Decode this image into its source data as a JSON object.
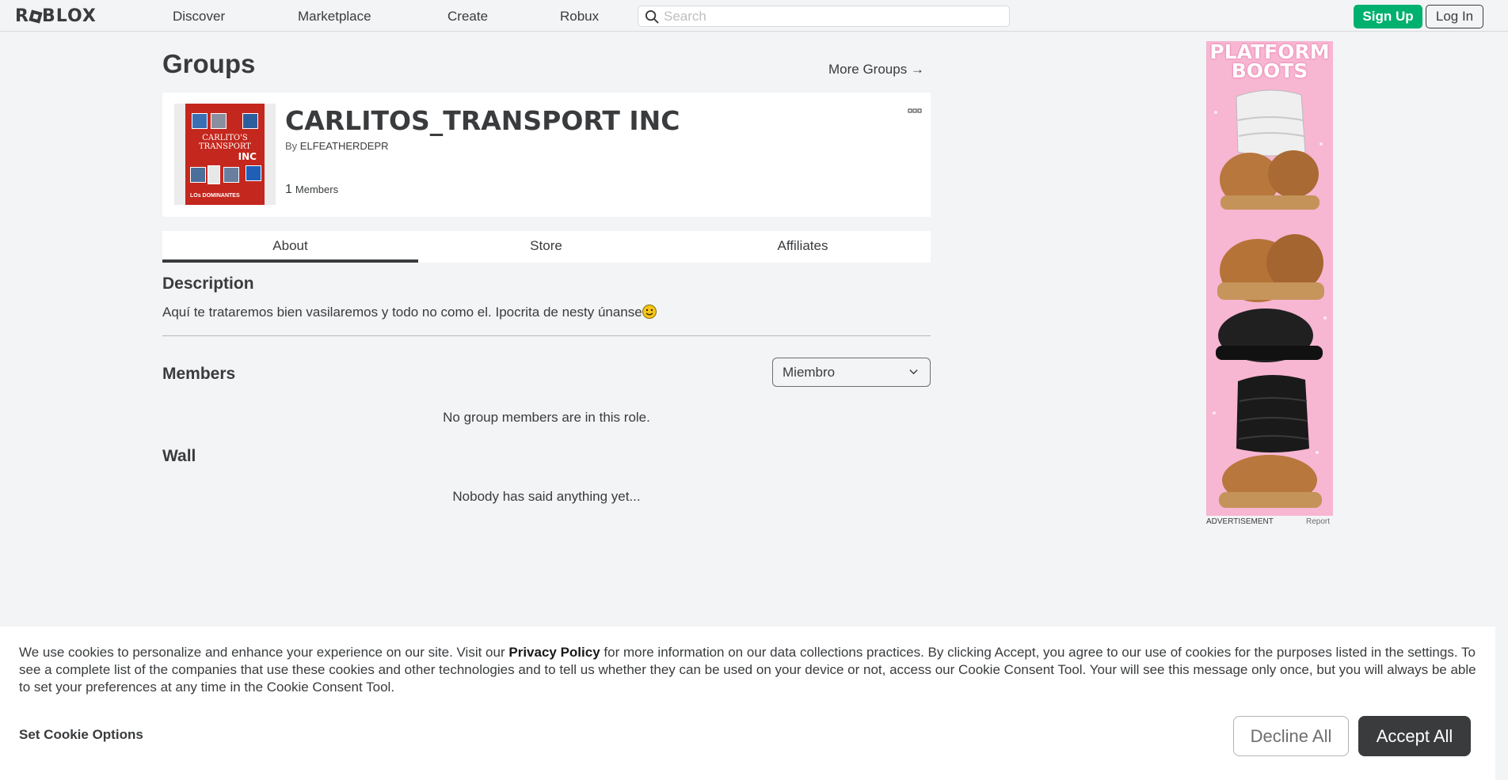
{
  "header": {
    "logo": "ROBLOX",
    "nav": [
      "Discover",
      "Marketplace",
      "Create",
      "Robux"
    ],
    "search_placeholder": "Search",
    "signup_label": "Sign Up",
    "login_label": "Log In"
  },
  "page": {
    "title": "Groups",
    "more_groups": "More Groups →"
  },
  "group": {
    "name": "CARLITOS_TRANSPORT INC",
    "by_label": "By",
    "owner": "ELFEATHERDEPR",
    "member_count": "1",
    "member_label": "Members",
    "thumbnail": {
      "line1": "CARLITO'S TRANSPORT",
      "line2": "INC",
      "bottom": "LOs DOMINANTES"
    }
  },
  "tabs": [
    "About",
    "Store",
    "Affiliates"
  ],
  "about": {
    "description_title": "Description",
    "description_text": "Aquí te trataremos bien vasilaremos y todo no como el. Ipocrita de nesty únanse",
    "members_title": "Members",
    "role_selected": "Miembro",
    "members_empty": "No group members are in this role.",
    "wall_title": "Wall",
    "wall_empty": "Nobody has said anything yet..."
  },
  "ad": {
    "title": "PLATFORM BOOTS",
    "label": "ADVERTISEMENT",
    "report": "Report"
  },
  "cookie": {
    "text_before": "We use cookies to personalize and enhance your experience on our site. Visit our ",
    "privacy_link": "Privacy Policy",
    "text_after": " for more information on our data collections practices. By clicking Accept, you agree to our use of cookies for the purposes listed in the settings. To see a complete list of the companies that use these cookies and other technologies and to tell us whether they can be used on your device or not, access our Cookie Consent Tool. Your will see this message only once, but you will always be able to set your preferences at any time in the Cookie Consent Tool.",
    "options_label": "Set Cookie Options",
    "decline_label": "Decline All",
    "accept_label": "Accept All"
  },
  "colors": {
    "signup": "#00b06f",
    "accept_bg": "#393b3d",
    "page_bg": "#f2f4f5",
    "ad_bg": "#f7b6d2"
  }
}
